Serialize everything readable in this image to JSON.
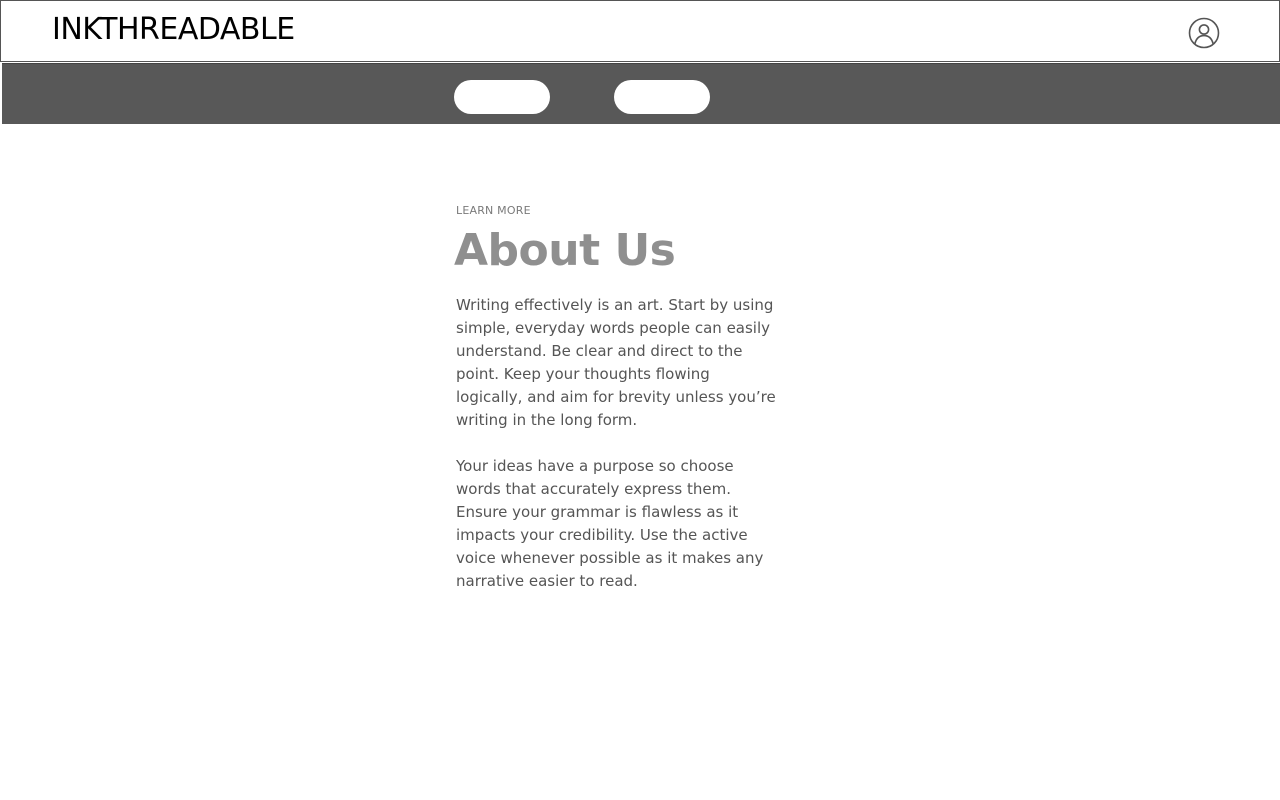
{
  "header": {
    "brand": "INKTHREADABLE",
    "account_icon": "user-circle-icon"
  },
  "nav": {
    "items": [
      {
        "label": ""
      },
      {
        "label": ""
      }
    ]
  },
  "about": {
    "eyebrow": "LEARN MORE",
    "title": "About Us",
    "paragraphs": [
      "Writing effectively is an art. Start by using simple, everyday words people can easily understand. Be clear and direct to the point. Keep your thoughts flowing logically, and aim for brevity unless you’re writing in the long form.",
      "Your ideas have a purpose so choose words that accurately express them. Ensure your grammar is flawless as it impacts your credibility. Use the active voice whenever possible as it makes any narrative easier to read."
    ]
  },
  "colors": {
    "nav_background": "#585858",
    "title": "#8f8f8f",
    "body_text": "#555555"
  }
}
